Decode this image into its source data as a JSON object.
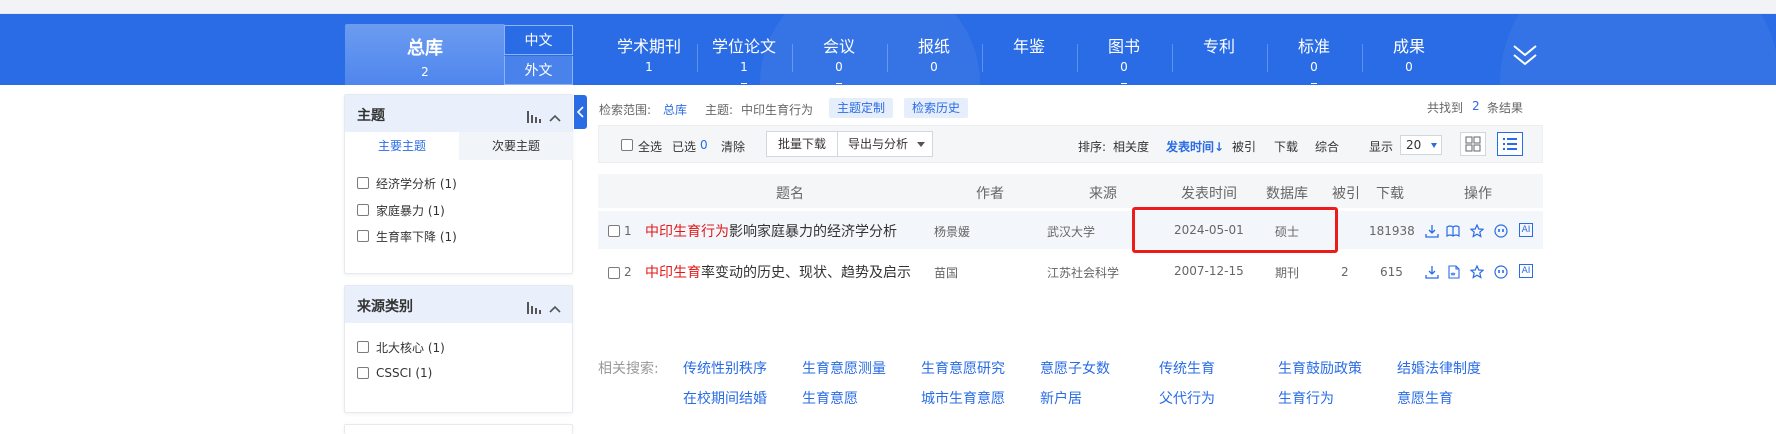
{
  "nav": {
    "total": {
      "label": "总库",
      "count": "2"
    },
    "lang_zh": "中文",
    "lang_wai": "外文",
    "items": [
      {
        "label": "学术期刊",
        "count": "1"
      },
      {
        "label": "学位论文",
        "count": "1"
      },
      {
        "label": "会议",
        "count": "0"
      },
      {
        "label": "报纸",
        "count": "0"
      },
      {
        "label": "年鉴",
        "count": ""
      },
      {
        "label": "图书",
        "count": "0"
      },
      {
        "label": "专利",
        "count": ""
      },
      {
        "label": "标准",
        "count": "0"
      },
      {
        "label": "成果",
        "count": "0"
      }
    ]
  },
  "sidebar": {
    "topic": {
      "title": "主题",
      "tab_main": "主要主题",
      "tab_sub": "次要主题",
      "items": [
        "经济学分析 (1)",
        "家庭暴力 (1)",
        "生育率下降 (1)"
      ]
    },
    "source": {
      "title": "来源类别",
      "items": [
        "北大核心 (1)",
        "CSSCI (1)"
      ]
    }
  },
  "search_info": {
    "scope_label": "检索范围:",
    "scope_value": "总库",
    "topic_label": "主题:",
    "topic_value": "中印生育行为",
    "custom_btn": "主题定制",
    "history_btn": "检索历史",
    "found_prefix": "共找到",
    "found_count": "2",
    "found_suffix": "条结果"
  },
  "toolbar": {
    "select_all": "全选",
    "selected_label": "已选",
    "selected_count": "0",
    "clear": "清除",
    "batch_download": "批量下载",
    "export_analysis": "导出与分析",
    "sort_label": "排序:",
    "sort_relevance": "相关度",
    "sort_time": "发表时间",
    "sort_cited": "被引",
    "sort_download": "下载",
    "sort_combined": "综合",
    "display_label": "显示",
    "display_value": "20"
  },
  "table": {
    "headers": [
      "题名",
      "作者",
      "来源",
      "发表时间",
      "数据库",
      "被引",
      "下载",
      "操作"
    ],
    "rows": [
      {
        "num": "1",
        "title_hl": "中印生育行为",
        "title_rest": "影响家庭暴力的经济学分析",
        "author": "杨景媛",
        "source": "武汉大学",
        "date": "2024-05-01",
        "db": "硕士",
        "cited": "",
        "downloads": "181938"
      },
      {
        "num": "2",
        "title_hl": "中印生育",
        "title_rest": "率变动的历史、现状、趋势及启示",
        "author": "苗国",
        "source": "江苏社会科学",
        "date": "2007-12-15",
        "db": "期刊",
        "cited": "2",
        "downloads": "615"
      }
    ],
    "op_ai": "AI"
  },
  "related": {
    "label": "相关搜索:",
    "row1": [
      "传统性别秩序",
      "生育意愿测量",
      "生育意愿研究",
      "意愿子女数",
      "传统生育",
      "生育鼓励政策",
      "结婚法律制度"
    ],
    "row2": [
      "在校期间结婚",
      "生育意愿",
      "城市生育意愿",
      "新户居",
      "父代行为",
      "生育行为",
      "意愿生育"
    ]
  },
  "colors": {
    "brand": "#2a6ce5",
    "highlight": "#e31919",
    "annotation_box": "#ee1b1b"
  }
}
